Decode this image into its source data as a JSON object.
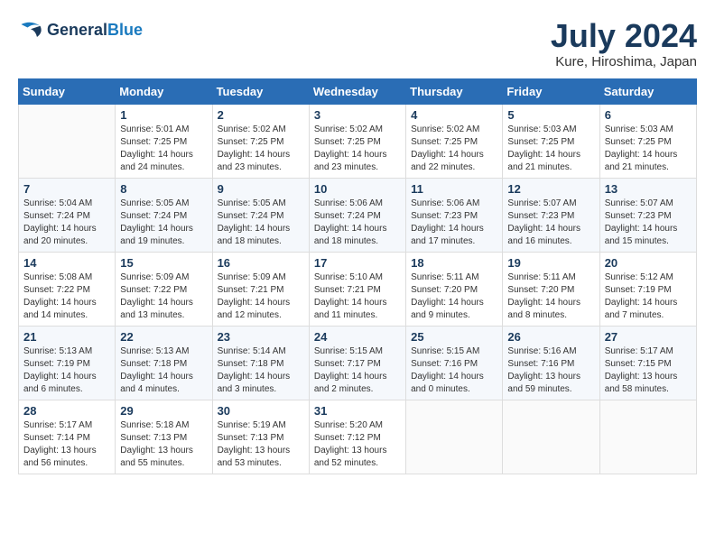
{
  "header": {
    "logo_line1": "General",
    "logo_line2": "Blue",
    "month": "July 2024",
    "location": "Kure, Hiroshima, Japan"
  },
  "days_of_week": [
    "Sunday",
    "Monday",
    "Tuesday",
    "Wednesday",
    "Thursday",
    "Friday",
    "Saturday"
  ],
  "weeks": [
    [
      {
        "day": "",
        "sunrise": "",
        "sunset": "",
        "daylight": ""
      },
      {
        "day": "1",
        "sunrise": "Sunrise: 5:01 AM",
        "sunset": "Sunset: 7:25 PM",
        "daylight": "Daylight: 14 hours and 24 minutes."
      },
      {
        "day": "2",
        "sunrise": "Sunrise: 5:02 AM",
        "sunset": "Sunset: 7:25 PM",
        "daylight": "Daylight: 14 hours and 23 minutes."
      },
      {
        "day": "3",
        "sunrise": "Sunrise: 5:02 AM",
        "sunset": "Sunset: 7:25 PM",
        "daylight": "Daylight: 14 hours and 23 minutes."
      },
      {
        "day": "4",
        "sunrise": "Sunrise: 5:02 AM",
        "sunset": "Sunset: 7:25 PM",
        "daylight": "Daylight: 14 hours and 22 minutes."
      },
      {
        "day": "5",
        "sunrise": "Sunrise: 5:03 AM",
        "sunset": "Sunset: 7:25 PM",
        "daylight": "Daylight: 14 hours and 21 minutes."
      },
      {
        "day": "6",
        "sunrise": "Sunrise: 5:03 AM",
        "sunset": "Sunset: 7:25 PM",
        "daylight": "Daylight: 14 hours and 21 minutes."
      }
    ],
    [
      {
        "day": "7",
        "sunrise": "Sunrise: 5:04 AM",
        "sunset": "Sunset: 7:24 PM",
        "daylight": "Daylight: 14 hours and 20 minutes."
      },
      {
        "day": "8",
        "sunrise": "Sunrise: 5:05 AM",
        "sunset": "Sunset: 7:24 PM",
        "daylight": "Daylight: 14 hours and 19 minutes."
      },
      {
        "day": "9",
        "sunrise": "Sunrise: 5:05 AM",
        "sunset": "Sunset: 7:24 PM",
        "daylight": "Daylight: 14 hours and 18 minutes."
      },
      {
        "day": "10",
        "sunrise": "Sunrise: 5:06 AM",
        "sunset": "Sunset: 7:24 PM",
        "daylight": "Daylight: 14 hours and 18 minutes."
      },
      {
        "day": "11",
        "sunrise": "Sunrise: 5:06 AM",
        "sunset": "Sunset: 7:23 PM",
        "daylight": "Daylight: 14 hours and 17 minutes."
      },
      {
        "day": "12",
        "sunrise": "Sunrise: 5:07 AM",
        "sunset": "Sunset: 7:23 PM",
        "daylight": "Daylight: 14 hours and 16 minutes."
      },
      {
        "day": "13",
        "sunrise": "Sunrise: 5:07 AM",
        "sunset": "Sunset: 7:23 PM",
        "daylight": "Daylight: 14 hours and 15 minutes."
      }
    ],
    [
      {
        "day": "14",
        "sunrise": "Sunrise: 5:08 AM",
        "sunset": "Sunset: 7:22 PM",
        "daylight": "Daylight: 14 hours and 14 minutes."
      },
      {
        "day": "15",
        "sunrise": "Sunrise: 5:09 AM",
        "sunset": "Sunset: 7:22 PM",
        "daylight": "Daylight: 14 hours and 13 minutes."
      },
      {
        "day": "16",
        "sunrise": "Sunrise: 5:09 AM",
        "sunset": "Sunset: 7:21 PM",
        "daylight": "Daylight: 14 hours and 12 minutes."
      },
      {
        "day": "17",
        "sunrise": "Sunrise: 5:10 AM",
        "sunset": "Sunset: 7:21 PM",
        "daylight": "Daylight: 14 hours and 11 minutes."
      },
      {
        "day": "18",
        "sunrise": "Sunrise: 5:11 AM",
        "sunset": "Sunset: 7:20 PM",
        "daylight": "Daylight: 14 hours and 9 minutes."
      },
      {
        "day": "19",
        "sunrise": "Sunrise: 5:11 AM",
        "sunset": "Sunset: 7:20 PM",
        "daylight": "Daylight: 14 hours and 8 minutes."
      },
      {
        "day": "20",
        "sunrise": "Sunrise: 5:12 AM",
        "sunset": "Sunset: 7:19 PM",
        "daylight": "Daylight: 14 hours and 7 minutes."
      }
    ],
    [
      {
        "day": "21",
        "sunrise": "Sunrise: 5:13 AM",
        "sunset": "Sunset: 7:19 PM",
        "daylight": "Daylight: 14 hours and 6 minutes."
      },
      {
        "day": "22",
        "sunrise": "Sunrise: 5:13 AM",
        "sunset": "Sunset: 7:18 PM",
        "daylight": "Daylight: 14 hours and 4 minutes."
      },
      {
        "day": "23",
        "sunrise": "Sunrise: 5:14 AM",
        "sunset": "Sunset: 7:18 PM",
        "daylight": "Daylight: 14 hours and 3 minutes."
      },
      {
        "day": "24",
        "sunrise": "Sunrise: 5:15 AM",
        "sunset": "Sunset: 7:17 PM",
        "daylight": "Daylight: 14 hours and 2 minutes."
      },
      {
        "day": "25",
        "sunrise": "Sunrise: 5:15 AM",
        "sunset": "Sunset: 7:16 PM",
        "daylight": "Daylight: 14 hours and 0 minutes."
      },
      {
        "day": "26",
        "sunrise": "Sunrise: 5:16 AM",
        "sunset": "Sunset: 7:16 PM",
        "daylight": "Daylight: 13 hours and 59 minutes."
      },
      {
        "day": "27",
        "sunrise": "Sunrise: 5:17 AM",
        "sunset": "Sunset: 7:15 PM",
        "daylight": "Daylight: 13 hours and 58 minutes."
      }
    ],
    [
      {
        "day": "28",
        "sunrise": "Sunrise: 5:17 AM",
        "sunset": "Sunset: 7:14 PM",
        "daylight": "Daylight: 13 hours and 56 minutes."
      },
      {
        "day": "29",
        "sunrise": "Sunrise: 5:18 AM",
        "sunset": "Sunset: 7:13 PM",
        "daylight": "Daylight: 13 hours and 55 minutes."
      },
      {
        "day": "30",
        "sunrise": "Sunrise: 5:19 AM",
        "sunset": "Sunset: 7:13 PM",
        "daylight": "Daylight: 13 hours and 53 minutes."
      },
      {
        "day": "31",
        "sunrise": "Sunrise: 5:20 AM",
        "sunset": "Sunset: 7:12 PM",
        "daylight": "Daylight: 13 hours and 52 minutes."
      },
      {
        "day": "",
        "sunrise": "",
        "sunset": "",
        "daylight": ""
      },
      {
        "day": "",
        "sunrise": "",
        "sunset": "",
        "daylight": ""
      },
      {
        "day": "",
        "sunrise": "",
        "sunset": "",
        "daylight": ""
      }
    ]
  ]
}
